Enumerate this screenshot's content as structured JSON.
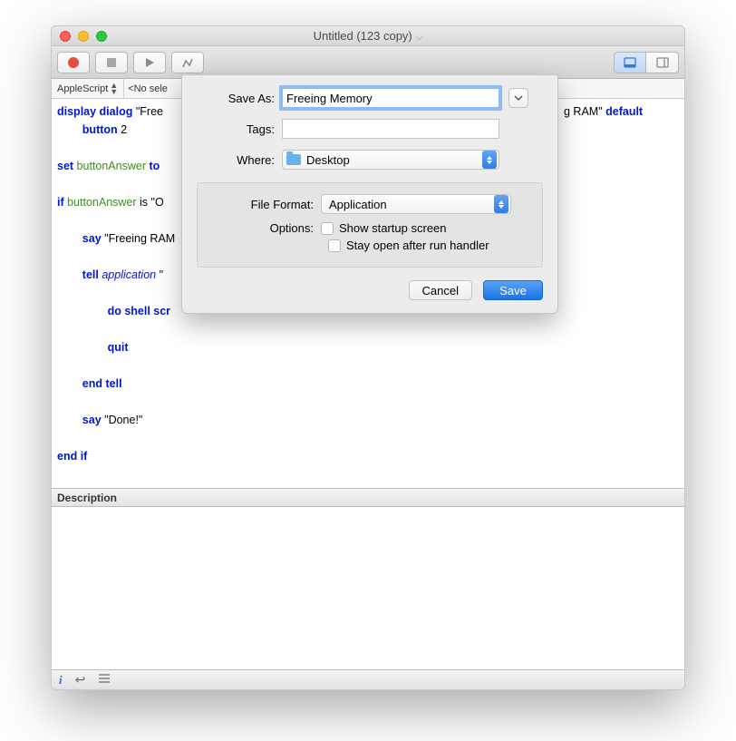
{
  "window": {
    "title": "Untitled (123 copy)"
  },
  "nav": {
    "language": "AppleScript",
    "selection": "<No sele"
  },
  "code": {
    "line1_a": "display dialog",
    "line1_b": " \"Free",
    "line1_tail_a": "g RAM\" ",
    "line1_tail_b": "default",
    "line2_a": "button",
    "line2_b": " 2",
    "line3_a": "set ",
    "line3_b": "buttonAnswer",
    "line3_c": " to ",
    "line4_a": "if ",
    "line4_b": "buttonAnswer",
    "line4_c": " is \"O",
    "line5_a": "say",
    "line5_b": " \"Freeing RAM",
    "line6_a": "tell",
    "line6_b": " application",
    "line6_c": " \"",
    "line7_a": "do shell scr",
    "line8_a": "quit",
    "line9_a": "end tell",
    "line10_a": "say",
    "line10_b": " \"Done!\"",
    "line11_a": "end if"
  },
  "desc": {
    "header": "Description"
  },
  "dialog": {
    "saveas_label": "Save As:",
    "saveas_value": "Freeing Memory",
    "tags_label": "Tags:",
    "tags_value": "",
    "where_label": "Where:",
    "where_value": "Desktop",
    "fileformat_label": "File Format:",
    "fileformat_value": "Application",
    "options_label": "Options:",
    "opt1": "Show startup screen",
    "opt2": "Stay open after run handler",
    "cancel": "Cancel",
    "save": "Save"
  }
}
